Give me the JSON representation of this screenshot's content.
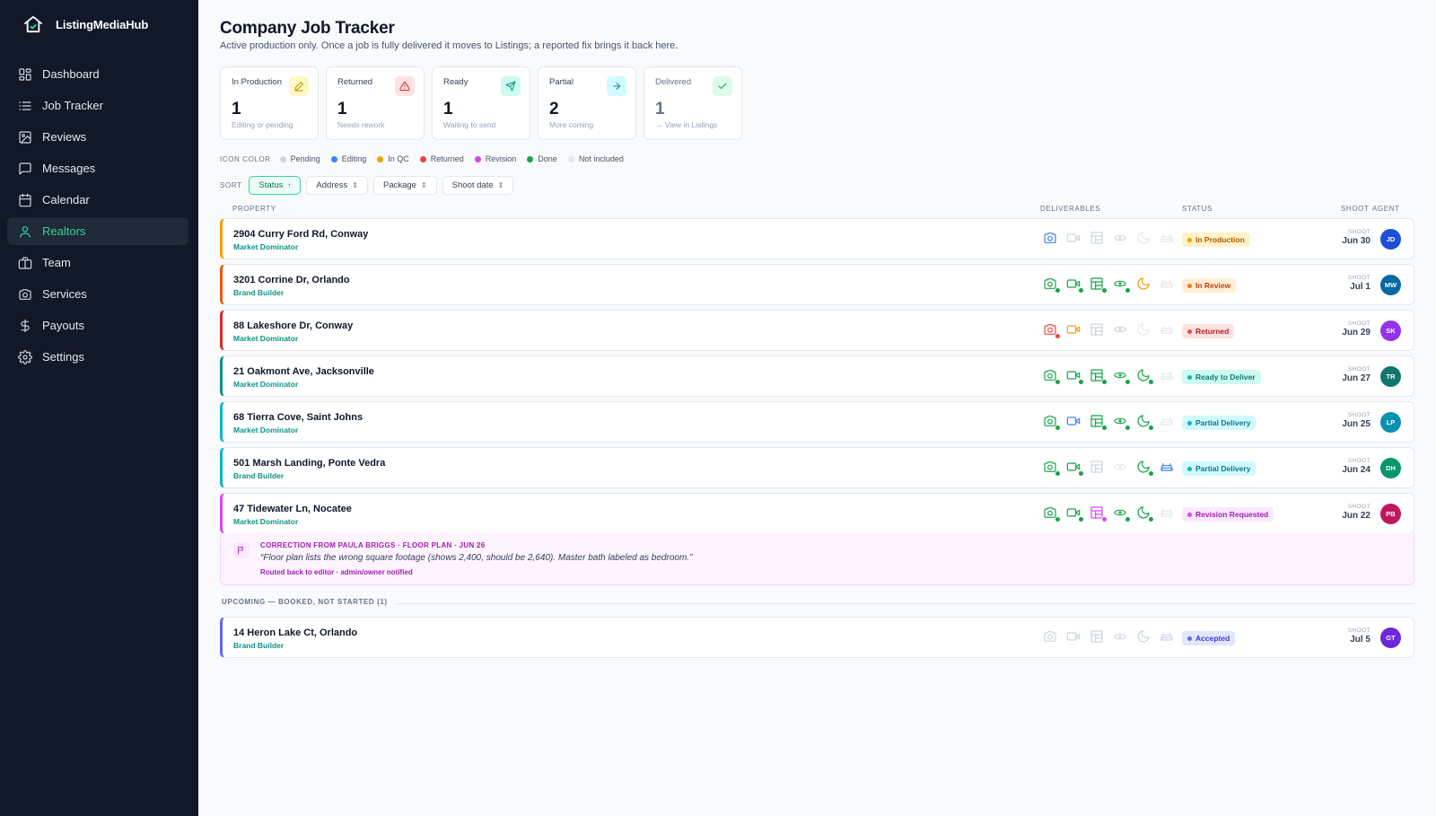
{
  "app": {
    "name": "ListingMediaHub"
  },
  "nav": [
    {
      "label": "Dashboard",
      "icon": "dashboard-icon",
      "active": false
    },
    {
      "label": "Job Tracker",
      "icon": "list-icon",
      "active": false
    },
    {
      "label": "Reviews",
      "icon": "image-icon",
      "active": false
    },
    {
      "label": "Messages",
      "icon": "message-icon",
      "active": false
    },
    {
      "label": "Calendar",
      "icon": "calendar-icon",
      "active": false
    },
    {
      "label": "Realtors",
      "icon": "user-icon",
      "active": true
    },
    {
      "label": "Team",
      "icon": "briefcase-icon",
      "active": false
    },
    {
      "label": "Services",
      "icon": "camera-icon",
      "active": false
    },
    {
      "label": "Payouts",
      "icon": "dollar-icon",
      "active": false
    },
    {
      "label": "Settings",
      "icon": "gear-icon",
      "active": false
    }
  ],
  "page": {
    "title": "Company Job Tracker",
    "subtitle": "Active production only. Once a job is fully delivered it moves to Listings; a reported fix brings it back here."
  },
  "stats": [
    {
      "label": "In Production",
      "value": "1",
      "sub": "Editing or pending",
      "icon": "pencil-icon",
      "color": "#ca8a04",
      "bg": "#fef9c3"
    },
    {
      "label": "Returned",
      "value": "1",
      "sub": "Needs rework",
      "icon": "alert-triangle-icon",
      "color": "#dc2626",
      "bg": "#fee2e2"
    },
    {
      "label": "Ready",
      "value": "1",
      "sub": "Waiting to send",
      "icon": "send-icon",
      "color": "#0d9488",
      "bg": "#ccfbf1"
    },
    {
      "label": "Partial",
      "value": "2",
      "sub": "More coming",
      "icon": "arrow-right-icon",
      "color": "#0891b2",
      "bg": "#cffafe"
    },
    {
      "label": "Delivered",
      "value": "1",
      "sub": "→ View in Listings",
      "icon": "check-icon",
      "color": "#16a34a",
      "bg": "#dcfce7"
    }
  ],
  "legend": {
    "title": "ICON COLOR",
    "items": [
      {
        "label": "Pending",
        "color": "#cbd5e1"
      },
      {
        "label": "Editing",
        "color": "#3b82f6"
      },
      {
        "label": "In QC",
        "color": "#f59e0b"
      },
      {
        "label": "Returned",
        "color": "#ef4444"
      },
      {
        "label": "Revision",
        "color": "#d946ef"
      },
      {
        "label": "Done",
        "color": "#16a34a"
      },
      {
        "label": "Not included",
        "color": "#e5e7eb"
      }
    ]
  },
  "sort": {
    "label": "SORT",
    "options": [
      {
        "label": "Status",
        "arrow": "↑",
        "active": true
      },
      {
        "label": "Address",
        "arrow": "⇕",
        "active": false
      },
      {
        "label": "Package",
        "arrow": "⇕",
        "active": false
      },
      {
        "label": "Shoot date",
        "arrow": "⇕",
        "active": false
      }
    ]
  },
  "columns": {
    "property": "PROPERTY",
    "deliverables": "DELIVERABLES",
    "status": "STATUS",
    "shoot": "SHOOT",
    "agent": "AGENT"
  },
  "deliverable_types": [
    "camera-icon",
    "video-icon",
    "floorplan-icon",
    "drone-icon",
    "twilight-icon",
    "staging-icon"
  ],
  "jobs": [
    {
      "address": "2904 Curry Ford Rd, Conway",
      "package": "Market Dominator",
      "accent": "#f59e0b",
      "deliverables": [
        "editing",
        "pending",
        "pending",
        "pending",
        "none",
        "none"
      ],
      "status": "In Production",
      "status_fg": "#b45309",
      "status_bg": "#fef3c7",
      "status_dot": "#f59e0b",
      "shoot_label": "SHOOT",
      "shoot_date": "Jun 30",
      "agent": "JD",
      "agent_color": "#1d4ed8"
    },
    {
      "address": "3201 Corrine Dr, Orlando",
      "package": "Brand Builder",
      "accent": "#ea580c",
      "deliverables": [
        "done",
        "done",
        "done",
        "done",
        "qc",
        "none"
      ],
      "status": "In Review",
      "status_fg": "#c2410c",
      "status_bg": "#ffedd5",
      "status_dot": "#f97316",
      "shoot_label": "SHOOT",
      "shoot_date": "Jul 1",
      "agent": "MW",
      "agent_color": "#0369a1"
    },
    {
      "address": "88 Lakeshore Dr, Conway",
      "package": "Market Dominator",
      "accent": "#dc2626",
      "deliverables": [
        "returned",
        "qc",
        "pending",
        "pending",
        "none",
        "none"
      ],
      "status": "Returned",
      "status_fg": "#b91c1c",
      "status_bg": "#fee2e2",
      "status_dot": "#ef4444",
      "shoot_label": "SHOOT",
      "shoot_date": "Jun 29",
      "agent": "SK",
      "agent_color": "#9333ea"
    },
    {
      "address": "21 Oakmont Ave, Jacksonville",
      "package": "Market Dominator",
      "accent": "#0d9488",
      "deliverables": [
        "done",
        "done",
        "done",
        "done",
        "done",
        "none"
      ],
      "status": "Ready to Deliver",
      "status_fg": "#0f766e",
      "status_bg": "#ccfbf1",
      "status_dot": "#14b8a6",
      "shoot_label": "SHOOT",
      "shoot_date": "Jun 27",
      "agent": "TR",
      "agent_color": "#0f766e"
    },
    {
      "address": "68 Tierra Cove, Saint Johns",
      "package": "Market Dominator",
      "accent": "#06b6d4",
      "deliverables": [
        "done",
        "editing",
        "done",
        "done",
        "done",
        "none"
      ],
      "status": "Partial Delivery",
      "status_fg": "#0e7490",
      "status_bg": "#cffafe",
      "status_dot": "#06b6d4",
      "shoot_label": "SHOOT",
      "shoot_date": "Jun 25",
      "agent": "LP",
      "agent_color": "#0891b2"
    },
    {
      "address": "501 Marsh Landing, Ponte Vedra",
      "package": "Brand Builder",
      "accent": "#06b6d4",
      "deliverables": [
        "done",
        "done",
        "pending",
        "none",
        "done",
        "editing"
      ],
      "status": "Partial Delivery",
      "status_fg": "#0e7490",
      "status_bg": "#cffafe",
      "status_dot": "#06b6d4",
      "shoot_label": "SHOOT",
      "shoot_date": "Jun 24",
      "agent": "DH",
      "agent_color": "#059669"
    },
    {
      "address": "47 Tidewater Ln, Nocatee",
      "package": "Market Dominator",
      "accent": "#d946ef",
      "deliverables": [
        "done",
        "done",
        "revision",
        "done",
        "done",
        "none"
      ],
      "status": "Revision Requested",
      "status_fg": "#a21caf",
      "status_bg": "#fae8ff",
      "status_dot": "#d946ef",
      "shoot_label": "SHOOT",
      "shoot_date": "Jun 22",
      "agent": "PB",
      "agent_color": "#be185d"
    }
  ],
  "correction": {
    "title": "CORRECTION FROM PAULA BRIGGS · FLOOR PLAN · JUN 26",
    "quote": "“Floor plan lists the wrong square footage (shows 2,400, should be 2,640). Master bath labeled as bedroom.”",
    "note": "Routed back to editor · admin/owner notified"
  },
  "upcoming": {
    "label": "UPCOMING — BOOKED, NOT STARTED (1)",
    "jobs": [
      {
        "address": "14 Heron Lake Ct, Orlando",
        "package": "Brand Builder",
        "accent": "#6366f1",
        "deliverables": [
          "pending",
          "pending",
          "pending",
          "pending",
          "pending",
          "pending"
        ],
        "status": "Accepted",
        "status_fg": "#4338ca",
        "status_bg": "#e0e7ff",
        "status_dot": "#6366f1",
        "shoot_label": "SHOOT",
        "shoot_date": "Jul 5",
        "agent": "GT",
        "agent_color": "#6d28d9"
      }
    ]
  }
}
